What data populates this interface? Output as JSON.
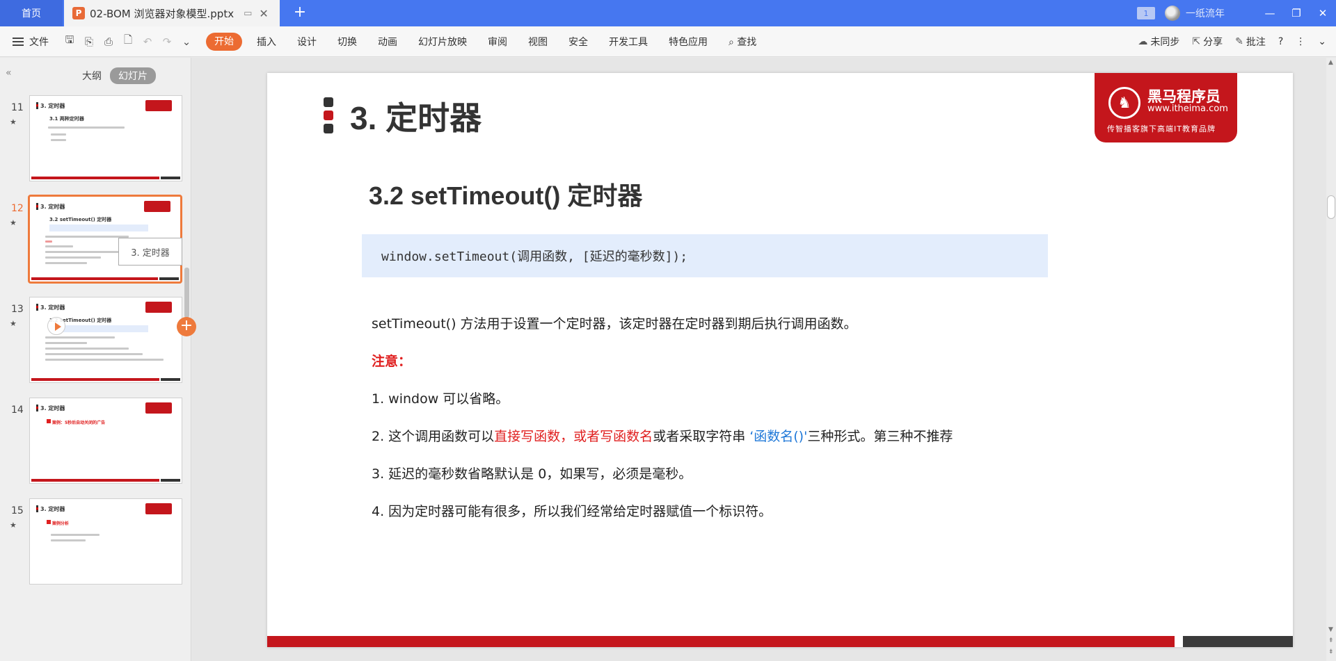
{
  "titlebar": {
    "home_tab": "首页",
    "doc_tab": "02-BOM 浏览器对象模型.pptx",
    "doc_icon": "P",
    "window_count": "1",
    "username": "一纸流年"
  },
  "menubar": {
    "file": "文件",
    "items": [
      "开始",
      "插入",
      "设计",
      "切换",
      "动画",
      "幻灯片放映",
      "审阅",
      "视图",
      "安全",
      "开发工具",
      "特色应用",
      "查找"
    ],
    "sync": "未同步",
    "share": "分享",
    "comment": "批注"
  },
  "leftpanel": {
    "outline": "大纲",
    "slides": "幻灯片",
    "tooltip": "3. 定时器",
    "thumbs": [
      {
        "num": "11",
        "title": "3. 定时器",
        "sub": "3.1 两种定时器"
      },
      {
        "num": "12",
        "title": "3. 定时器",
        "sub": "3.2 setTimeout() 定时器"
      },
      {
        "num": "13",
        "title": "3. 定时器",
        "sub": "3.2 setTimeout() 定时器"
      },
      {
        "num": "14",
        "title": "3. 定时器",
        "sub": "案例：5秒后自动关闭的广告"
      },
      {
        "num": "15",
        "title": "3. 定时器",
        "sub": "案例分析"
      }
    ]
  },
  "slide": {
    "title": "3. 定时器",
    "subtitle": "3.2 setTimeout() 定时器",
    "code": "window.setTimeout(调用函数, [延迟的毫秒数]);",
    "desc": "setTimeout() 方法用于设置一个定时器，该定时器在定时器到期后执行调用函数。",
    "note": "注意：",
    "p1": "1. window 可以省略。",
    "p2_a": "2. 这个调用函数可以",
    "p2_b": "直接写函数，或者写函数名",
    "p2_c": "或者采取字符串 ",
    "p2_d": "‘函数名()'",
    "p2_e": "三种形式。第三种不推荐",
    "p3": "3. 延迟的毫秒数省略默认是 0，如果写，必须是毫秒。",
    "p4": "4. 因为定时器可能有很多，所以我们经常给定时器赋值一个标识符。",
    "logo_cn": "黑马程序员",
    "logo_url": "www.itheima.com",
    "logo_tag": "传智播客旗下高端IT教育品牌"
  },
  "colors": {
    "titlebar": "#4677f0",
    "accent": "#ec6b32",
    "brand_red": "#c4161c",
    "note_red": "#e02020",
    "link_blue": "#1f78d8",
    "code_bg": "#e3edfc"
  }
}
